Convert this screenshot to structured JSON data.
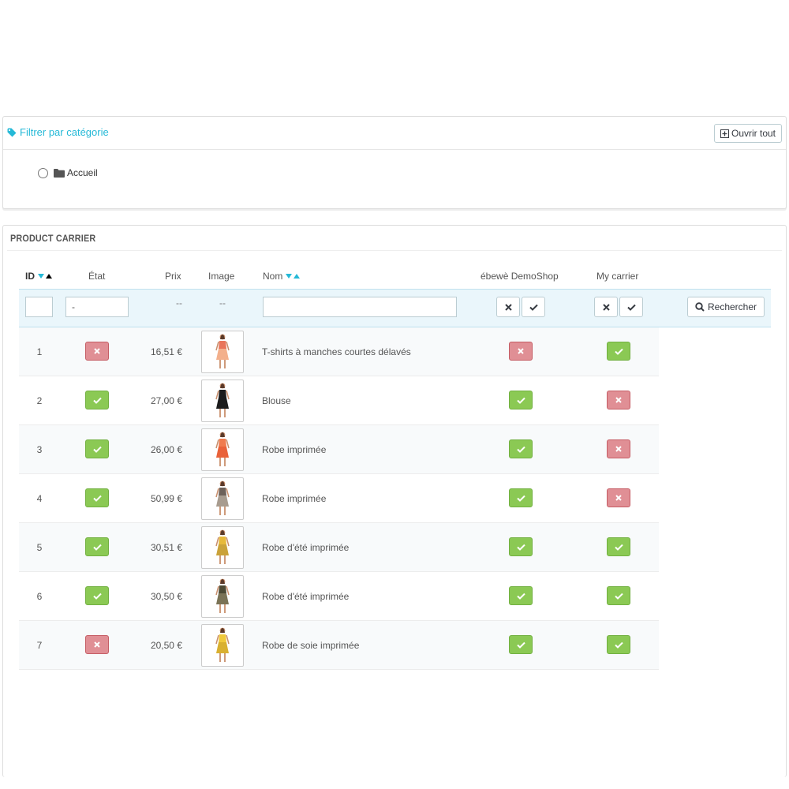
{
  "category_filter": {
    "title": "Filtrer par catégorie",
    "open_all_label": "Ouvrir tout",
    "tree_root": "Accueil"
  },
  "product_carrier": {
    "title": "PRODUCT CARRIER",
    "columns": {
      "id": "ID",
      "state": "État",
      "price": "Prix",
      "image": "Image",
      "name": "Nom",
      "carrier1": "ébewè DemoShop",
      "carrier2": "My carrier"
    },
    "filters": {
      "id_value": "",
      "state_value": "-",
      "price_placeholder": "--",
      "image_placeholder": "--",
      "name_value": "",
      "search_label": "Rechercher"
    },
    "rows": [
      {
        "id": "1",
        "active": false,
        "price": "16,51 €",
        "name": "T-shirts à manches courtes délavés",
        "carrier1": false,
        "carrier2": true,
        "image": "dress-orange-top"
      },
      {
        "id": "2",
        "active": true,
        "price": "27,00 €",
        "name": "Blouse",
        "carrier1": true,
        "carrier2": false,
        "image": "dress-black-blouse"
      },
      {
        "id": "3",
        "active": true,
        "price": "26,00 €",
        "name": "Robe imprimée",
        "carrier1": true,
        "carrier2": false,
        "image": "dress-orange"
      },
      {
        "id": "4",
        "active": true,
        "price": "50,99 €",
        "name": "Robe imprimée",
        "carrier1": true,
        "carrier2": false,
        "image": "dress-printed-grey"
      },
      {
        "id": "5",
        "active": true,
        "price": "30,51 €",
        "name": "Robe d'été imprimée",
        "carrier1": true,
        "carrier2": true,
        "image": "dress-yellow-long"
      },
      {
        "id": "6",
        "active": true,
        "price": "30,50 €",
        "name": "Robe d'été imprimée",
        "carrier1": true,
        "carrier2": true,
        "image": "dress-dark-print"
      },
      {
        "id": "7",
        "active": false,
        "price": "20,50 €",
        "name": "Robe de soie imprimée",
        "carrier1": true,
        "carrier2": true,
        "image": "dress-yellow-silk"
      }
    ]
  },
  "colors": {
    "accent": "#25b9d7",
    "status_on": "#8bc954",
    "status_off": "#e08f95"
  }
}
